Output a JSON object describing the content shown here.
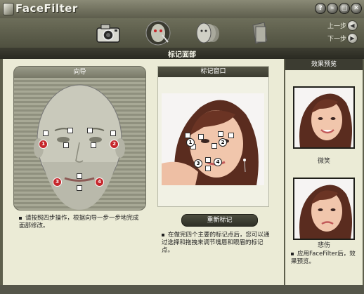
{
  "app": {
    "title": "FaceFilter"
  },
  "window_buttons": [
    {
      "name": "help",
      "glyph": "?"
    },
    {
      "name": "minimize",
      "glyph": "–"
    },
    {
      "name": "restore",
      "glyph": "□"
    },
    {
      "name": "close",
      "glyph": "✕"
    }
  ],
  "toolbar": {
    "steps": [
      {
        "icon": "camera-icon"
      },
      {
        "icon": "face-mark-icon"
      },
      {
        "icon": "faces-icon"
      },
      {
        "icon": "document-icon"
      }
    ],
    "prev_label": "上一步",
    "next_label": "下一步",
    "prev_glyph": "◀",
    "next_glyph": "▶"
  },
  "section": {
    "title": "标记面部"
  },
  "guide": {
    "title": "向导",
    "points": [
      "1",
      "2",
      "3",
      "4"
    ],
    "instruction": "请按照四步操作，根据向导一步一步地完成面部修改。"
  },
  "mark_window": {
    "title": "标记窗口",
    "points": [
      "1",
      "2",
      "3",
      "4"
    ],
    "redo_button": "重新标记",
    "instruction": "在做完四个主要的标记点后，您可以通过选择和拖拽来调节嘴唇和眼眉的标记点。"
  },
  "preview": {
    "title": "效果预览",
    "items": [
      {
        "label": "微笑"
      },
      {
        "label": "悲伤"
      }
    ],
    "note": "应用FaceFilter后，效果预览。"
  },
  "colors": {
    "accent_red": "#c5262b",
    "panel_bg": "#ebebd6",
    "chrome": "#5e5f4c"
  }
}
